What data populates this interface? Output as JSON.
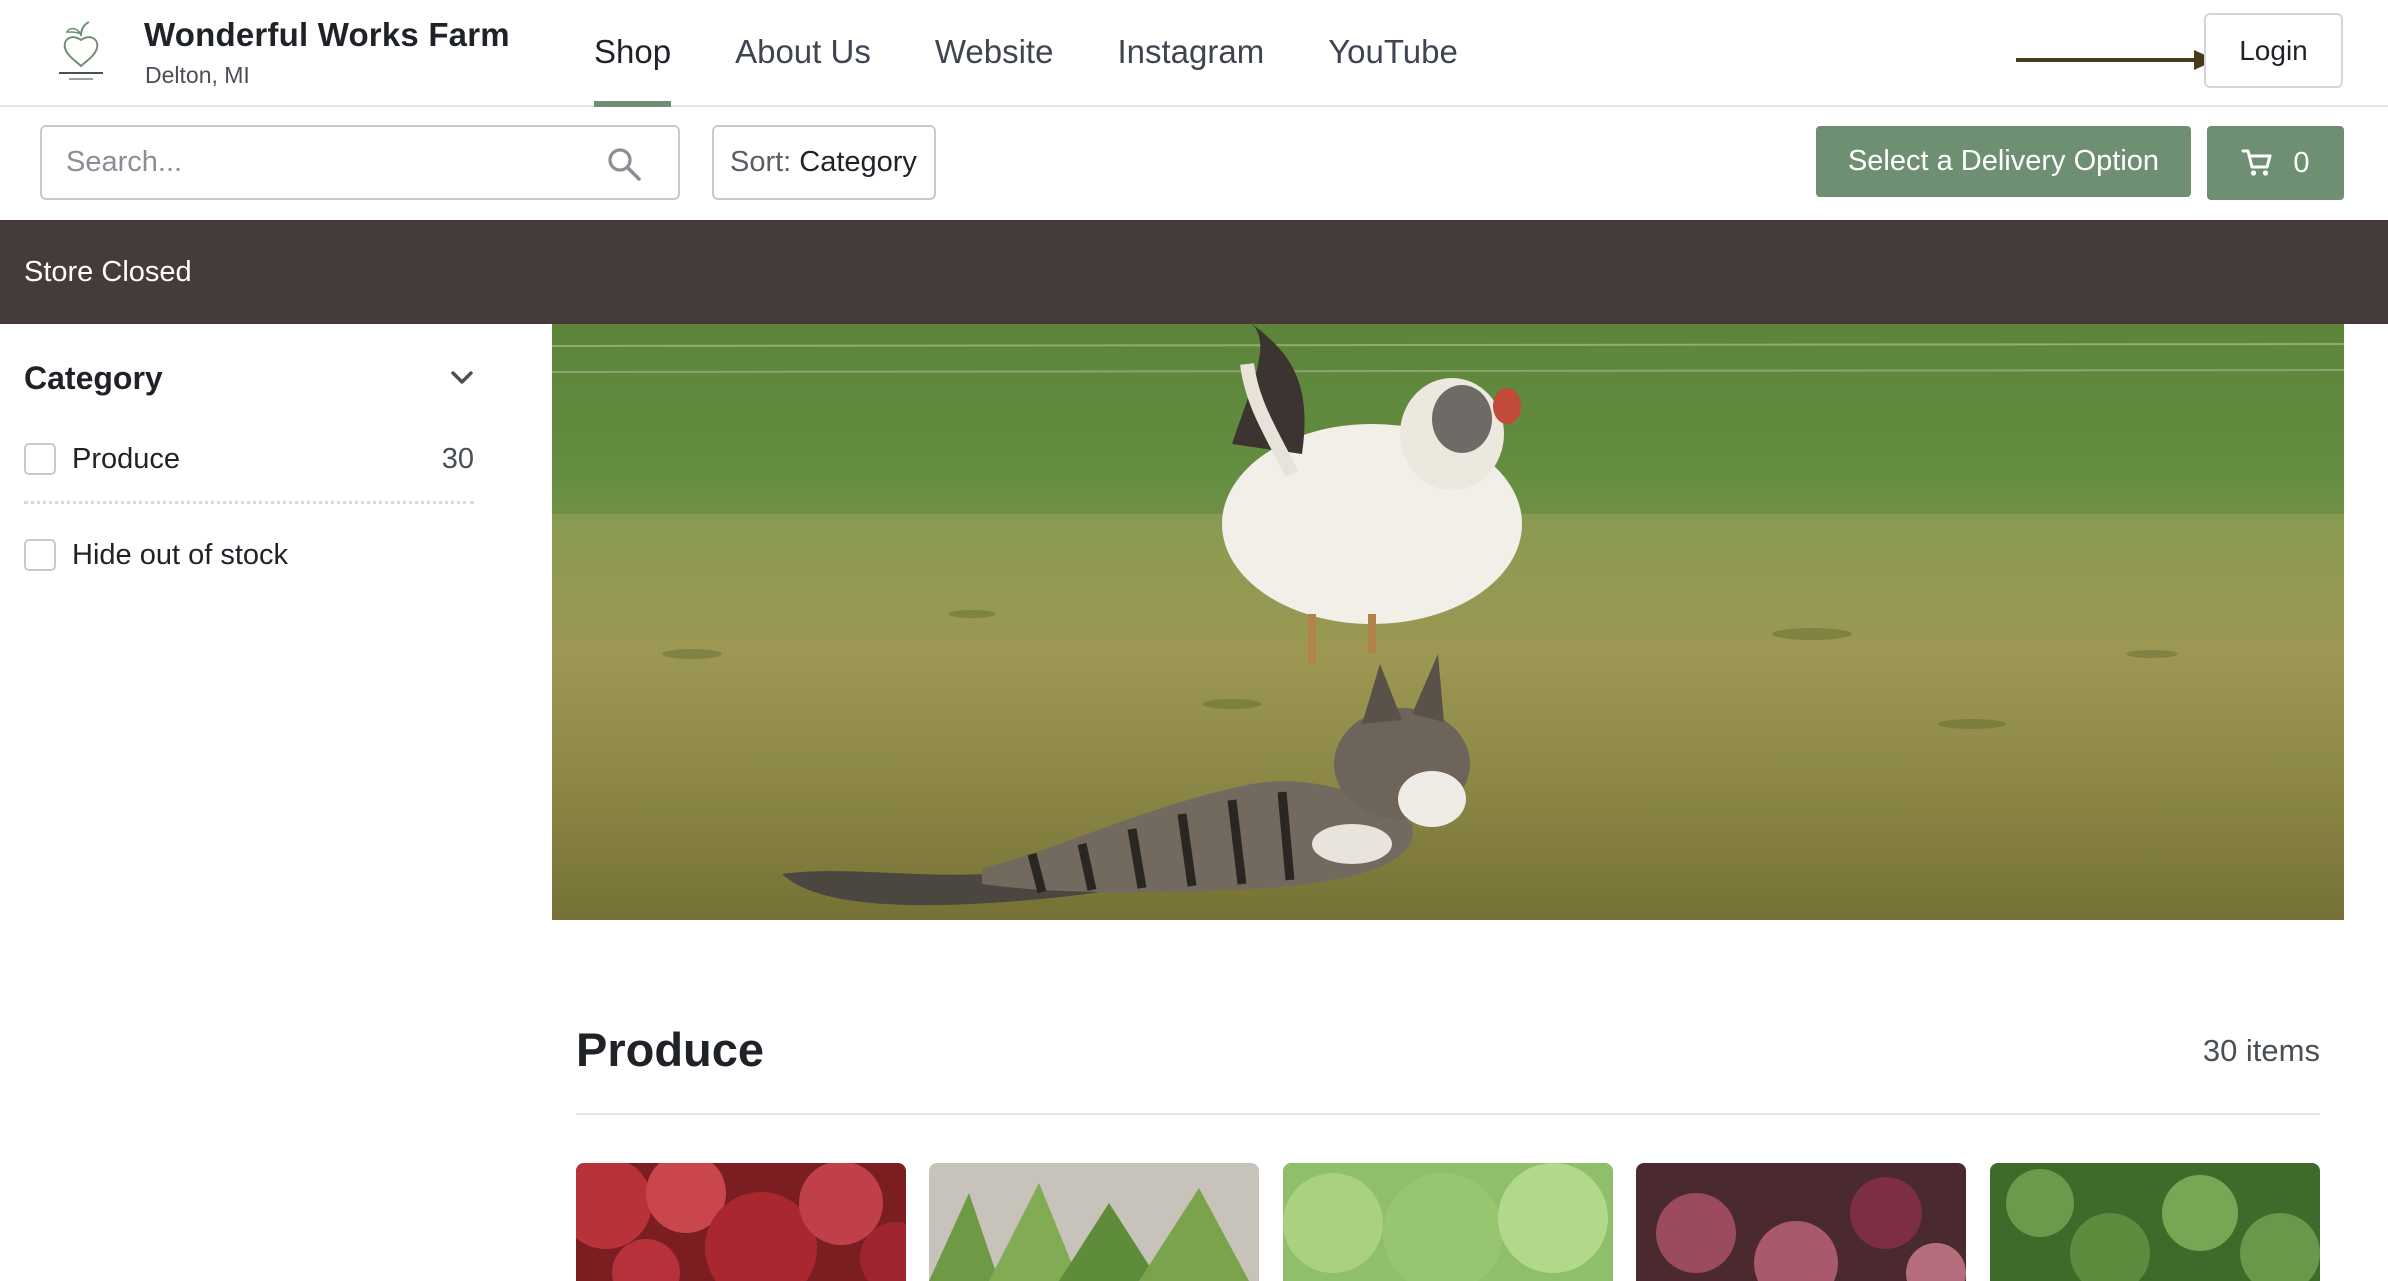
{
  "header": {
    "farm_name": "Wonderful Works Farm",
    "location": "Delton, MI",
    "logo_icon": "apple-heart-logo-icon",
    "nav": [
      {
        "label": "Shop",
        "active": true
      },
      {
        "label": "About Us",
        "active": false
      },
      {
        "label": "Website",
        "active": false
      },
      {
        "label": "Instagram",
        "active": false
      },
      {
        "label": "YouTube",
        "active": false
      }
    ],
    "login_label": "Login"
  },
  "toolbar": {
    "search_placeholder": "Search...",
    "sort_prefix": "Sort:",
    "sort_value": "Category",
    "delivery_label": "Select a Delivery Option",
    "cart_count": "0"
  },
  "banner": {
    "text": "Store Closed"
  },
  "sidebar": {
    "category_title": "Category",
    "produce_label": "Produce",
    "produce_count": "30",
    "hide_out_of_stock_label": "Hide out of stock"
  },
  "section": {
    "title": "Produce",
    "count": "30 items"
  },
  "colors": {
    "accent": "#6f8f73",
    "banner": "#453b39",
    "arrow": "#4a3a1c"
  },
  "products": [
    {
      "icon": "apples-image"
    },
    {
      "icon": "greens-image"
    },
    {
      "icon": "lettuce-image"
    },
    {
      "icon": "beets-image"
    },
    {
      "icon": "broccoli-image"
    }
  ]
}
